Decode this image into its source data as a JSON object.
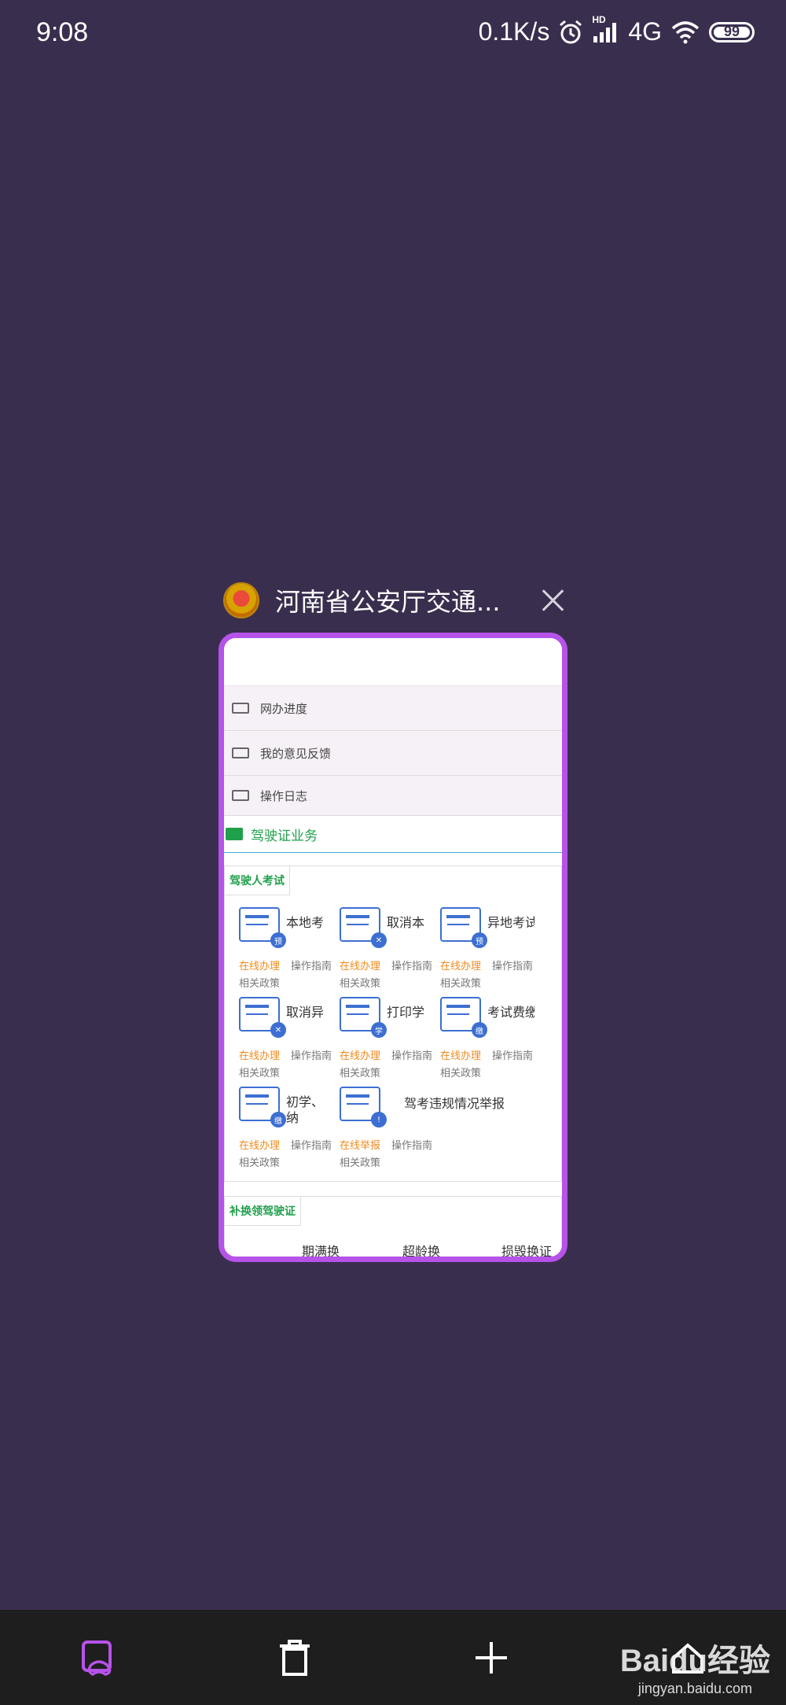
{
  "status_bar": {
    "time": "9:08",
    "speed": "0.1K/s",
    "network": "4G",
    "hd_label": "HD",
    "battery": "99"
  },
  "tab": {
    "title": "河南省公安厅交通...",
    "favicon": "police-badge-icon"
  },
  "preview": {
    "menu_items": [
      {
        "label": "网办进度",
        "icon": "card-icon"
      },
      {
        "label": "我的意见反馈",
        "icon": "folder-icon"
      },
      {
        "label": "操作日志",
        "icon": "folder-icon"
      }
    ],
    "section_title": "驾驶证业务",
    "group1_label": "驾驶人考试",
    "services": [
      {
        "name": "本地考",
        "badge": "预",
        "action": "在线办理",
        "guide": "操作指南",
        "policy": "相关政策"
      },
      {
        "name": "取消本",
        "badge": "✕",
        "action": "在线办理",
        "guide": "操作指南",
        "policy": "相关政策"
      },
      {
        "name": "异地考试预",
        "badge": "预",
        "action": "在线办理",
        "guide": "操作指南",
        "policy": "相关政策"
      },
      {
        "name": "取消异",
        "badge": "✕",
        "action": "在线办理",
        "guide": "操作指南",
        "policy": "相关政策"
      },
      {
        "name": "打印学",
        "badge": "学",
        "action": "在线办理",
        "guide": "操作指南",
        "policy": "相关政策"
      },
      {
        "name": "考试费缴纳",
        "badge": "缴",
        "action": "在线办理",
        "guide": "操作指南",
        "policy": "相关政策"
      },
      {
        "name": "初学、",
        "name2": "纳",
        "badge": "缴",
        "action": "在线办理",
        "guide": "操作指南",
        "policy": "相关政策"
      },
      {
        "name": "",
        "badge": "!",
        "action": "在线举报",
        "guide": "操作指南",
        "policy": "相关政策"
      }
    ],
    "report_label": "驾考违规情况举报",
    "group2_label": "补换领驾驶证",
    "group2_items": [
      "期满换",
      "超龄换",
      "损毁换证"
    ]
  },
  "bottom_nav": {
    "items": [
      "tabs-icon",
      "trash-icon",
      "plus-icon",
      "home-icon"
    ]
  },
  "watermark": {
    "brand": "Baidu经验",
    "url": "jingyan.baidu.com"
  }
}
